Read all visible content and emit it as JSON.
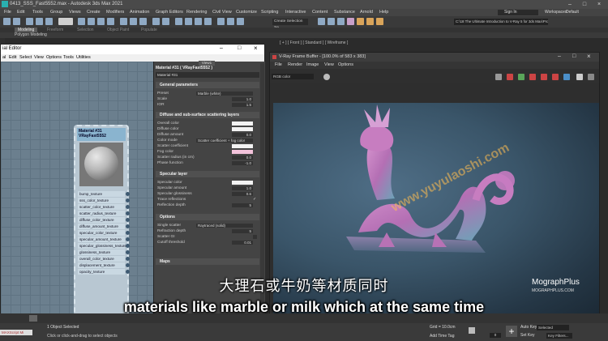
{
  "app": {
    "title": "0413_SSS_Fast5552.max - Autodesk 3ds Max 2021",
    "menu": [
      "File",
      "Edit",
      "Tools",
      "Group",
      "Views",
      "Create",
      "Modifiers",
      "Animation",
      "Graph Editors",
      "Rendering",
      "Civil View",
      "Customize",
      "Scripting",
      "Interactive",
      "Content",
      "Substance",
      "Arnold",
      "Help"
    ],
    "sign_in": "Sign In",
    "workspaces_label": "Workspaces:",
    "workspace_value": "Default",
    "path": "C:\\18 The Ultimate Introduction to V-Ray 5 for 3ds Max\\Project Files",
    "create_selection": "Create Selection Se",
    "ribbon_tabs": [
      "Modeling",
      "Freeform",
      "Selection",
      "Object Paint",
      "Populate"
    ],
    "ribbon_sub": "Polygon Modeling",
    "viewport_label": "[ + ] [ Front ] [ Standard ] [ Wireframe ]"
  },
  "material_editor": {
    "title": "ial Editor",
    "menu": [
      "al",
      "Edit",
      "Select",
      "View",
      "Options",
      "Tools",
      "Utilities"
    ],
    "view_tab": "View1",
    "header_name": "Material #31 ( VRayFast5552 )",
    "material_name": "Material #31",
    "node": {
      "title_line1": "Material #31",
      "title_line2": "VRayFast5552",
      "slots": [
        "bump_texture",
        "sss_color_texture",
        "scatter_color_texture",
        "scatter_radius_texture",
        "diffuse_color_texture",
        "diffuse_amount_texture",
        "specular_color_texture",
        "specular_amount_texture",
        "specular_glossiness_texture",
        "glossiness_texture",
        "overall_color_texture",
        "displacement_texture",
        "opacity_texture"
      ]
    },
    "sections": {
      "general": {
        "label": "General parameters",
        "preset_label": "Preset",
        "preset_value": "Marble (white)",
        "scale_label": "Scale",
        "scale_value": "1.0",
        "ior_label": "IOR",
        "ior_value": "1.5"
      },
      "diffuse": {
        "label": "Diffuse and sub-surface scattering layers",
        "overall_color": "Overall color",
        "diffuse_color": "Diffuse color",
        "diffuse_amount": "Diffuse amount",
        "diffuse_amount_value": "0.0",
        "color_mode": "Color mode",
        "color_mode_value": "Scatter coefficient + fog color",
        "scatter_color": "Scatter coefficient",
        "fog_color": "Fog color",
        "scatter_radius": "Scatter radius (in cm)",
        "scatter_radius_value": "0.0",
        "phase_function": "Phase function",
        "phase_function_value": "-1.0"
      },
      "specular": {
        "label": "Specular layer",
        "specular_color": "Specular color",
        "specular_amount": "Specular amount",
        "specular_amount_value": "1.0",
        "specular_glossiness": "Specular glossiness",
        "specular_glossiness_value": "0.6",
        "trace_reflections": "Trace reflections",
        "reflection_depth": "Reflection depth",
        "reflection_depth_value": "5"
      },
      "options": {
        "label": "Options",
        "single_scatter": "Single scatter",
        "single_scatter_value": "Raytraced (solid)",
        "refraction_depth": "Refraction depth",
        "refraction_depth_value": "5",
        "scatter_gi": "Scatter GI",
        "cutoff_threshold": "Cutoff threshold",
        "cutoff_threshold_value": "0.01"
      },
      "maps": {
        "label": "Maps"
      }
    }
  },
  "frame_buffer": {
    "title": "V-Ray Frame Buffer - [100.0% of 583 x 383]",
    "menu": [
      "File",
      "Render",
      "Image",
      "View",
      "Options"
    ],
    "channel": "RGB color"
  },
  "subtitles": {
    "chinese": "大理石或牛奶等材质同时",
    "english": "materials like marble or milk which at the same time"
  },
  "branding": {
    "logo": "MographPlus",
    "url": "MOGRAPHPLUS.COM",
    "watermark": "www.yuyulaoshi.com"
  },
  "status": {
    "selected": "1 Object Selected",
    "hint": "Click or click-and-drag to select objects",
    "maxscript": "MAXScript Mi",
    "grid": "Grid = 10.0cm",
    "add_time_tag": "Add Time Tag",
    "auto_key": "Auto Key",
    "selected_dropdown": "Selected",
    "set_key": "Set Key",
    "key_filters": "Key Filters...",
    "frame": "0"
  },
  "colors": {
    "node_header": "#8ab4cf",
    "fog_color": "#f2c2da",
    "render_bg": "#3a5569",
    "dragon": "#c56fbf"
  }
}
